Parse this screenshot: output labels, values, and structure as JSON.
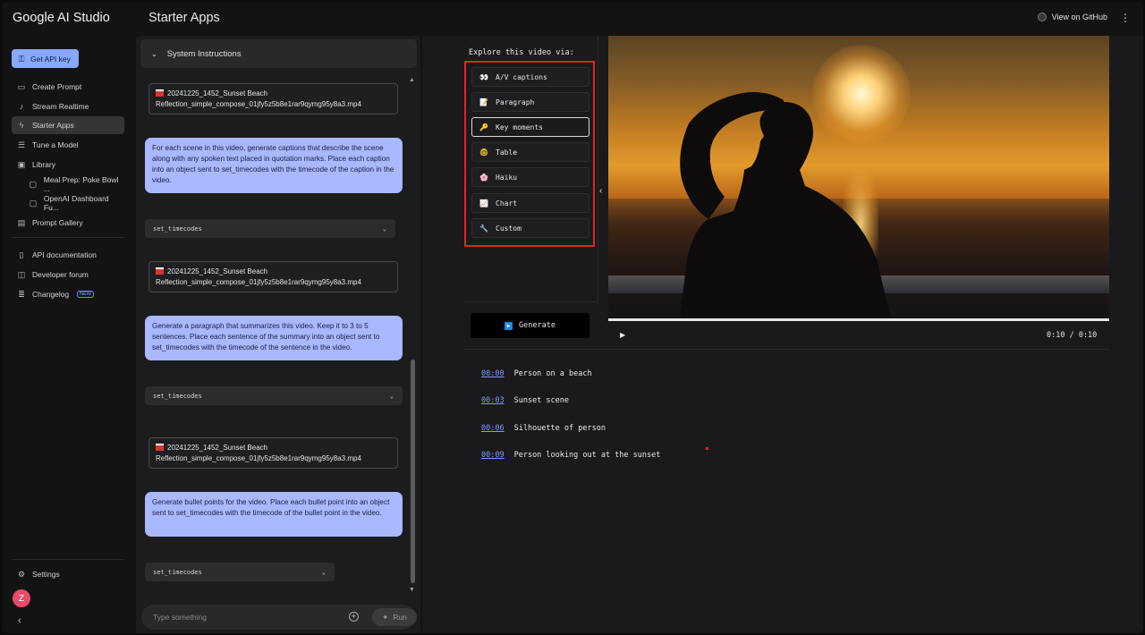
{
  "header": {
    "brand": "Google AI Studio",
    "page_title": "Starter Apps",
    "github_label": "View on GitHub",
    "more_glyph": "⋮"
  },
  "sidebar": {
    "api_key_label": "Get API key",
    "items": [
      {
        "label": "Create Prompt",
        "icon": "create-prompt-icon"
      },
      {
        "label": "Stream Realtime",
        "icon": "microphone-icon"
      },
      {
        "label": "Starter Apps",
        "icon": "bolt-icon",
        "active": true
      },
      {
        "label": "Tune a Model",
        "icon": "tune-icon"
      },
      {
        "label": "Library",
        "icon": "library-icon"
      },
      {
        "label": "Meal Prep: Poke Bowl ...",
        "icon": "chat-icon"
      },
      {
        "label": "OpenAI Dashboard Fu...",
        "icon": "chat-icon"
      },
      {
        "label": "Prompt Gallery",
        "icon": "gallery-icon"
      },
      {
        "label": "API documentation",
        "icon": "document-icon"
      },
      {
        "label": "Developer forum",
        "icon": "forum-icon"
      },
      {
        "label": "Changelog",
        "icon": "changelog-icon",
        "badge": "NEW"
      }
    ],
    "settings_label": "Settings",
    "avatar_letter": "Z",
    "collapse_glyph": "‹"
  },
  "chat": {
    "system_instructions_label": "System Instructions",
    "file_name_line1": "20241225_1452_Sunset Beach",
    "file_name_line2": "Reflection_simple_compose_01jfy5z5b8e1rar9qymg95y8a3.mp4",
    "prompts": [
      "For each scene in this video, generate captions that describe the scene along with any spoken text placed in quotation marks. Place each caption into an object sent to set_timecodes with the timecode of the caption in the video.",
      "Generate a paragraph that summarizes this video. Keep it to 3 to 5 sentences. Place each sentence of the summary into an object sent to set_timecodes with the timecode of the sentence in the video.",
      "Generate bullet points for the video. Place each bullet point into an object sent to set_timecodes with the timecode of the bullet point in the video."
    ],
    "function_label": "set_timecodes",
    "input_placeholder": "Type something",
    "run_label": "Run"
  },
  "app": {
    "explore_label": "Explore this video via:",
    "modes": [
      {
        "label": "A/V captions",
        "icon": "captions-icon",
        "glyph": "👀"
      },
      {
        "label": "Paragraph",
        "icon": "paragraph-icon",
        "glyph": "📝"
      },
      {
        "label": "Key moments",
        "icon": "key-icon",
        "glyph": "🔑",
        "active": true
      },
      {
        "label": "Table",
        "icon": "table-icon",
        "glyph": "🤓"
      },
      {
        "label": "Haiku",
        "icon": "haiku-icon",
        "glyph": "🌸"
      },
      {
        "label": "Chart",
        "icon": "chart-icon",
        "glyph": "📈"
      },
      {
        "label": "Custom",
        "icon": "custom-icon",
        "glyph": "🔧"
      }
    ],
    "generate_label": "Generate",
    "video_time": "0:10 / 0:10",
    "captions": [
      {
        "time": "00:00",
        "text": "Person on a beach"
      },
      {
        "time": "00:03",
        "text": "Sunset scene"
      },
      {
        "time": "00:06",
        "text": "Silhouette of person"
      },
      {
        "time": "00:09",
        "text": "Person looking out at the sunset"
      }
    ]
  },
  "colors": {
    "accent": "#87a9ff",
    "prompt_bubble": "#a9b8ff",
    "highlight_box": "#e0261d",
    "link_time": "#7f9cff"
  }
}
